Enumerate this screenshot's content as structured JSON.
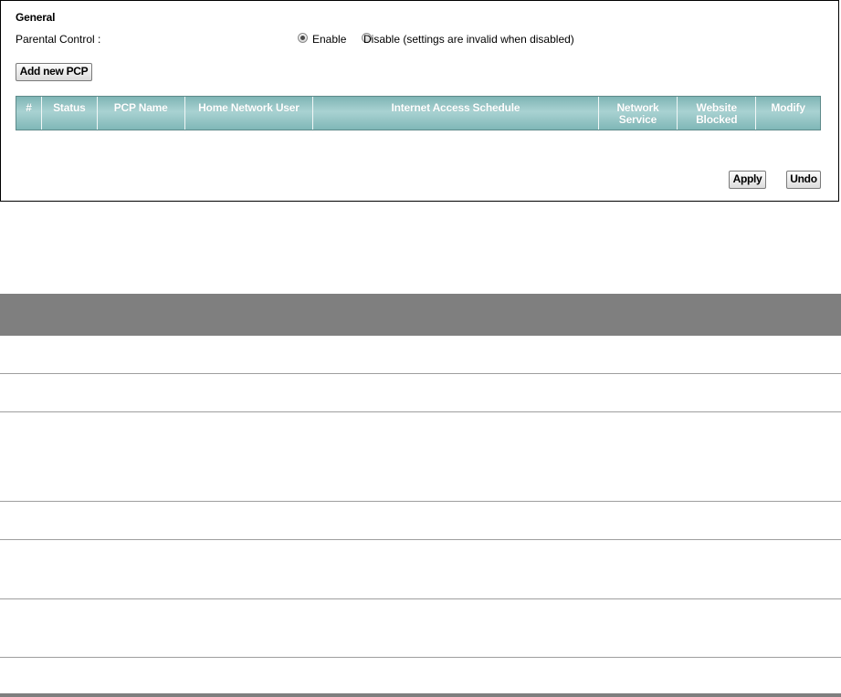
{
  "general": {
    "section_title": "General",
    "parental_control_label": "Parental Control :",
    "enable_label": "Enable",
    "disable_label": "Disable (settings are invalid when disabled)",
    "selected": "Enable"
  },
  "buttons": {
    "add_new": "Add new PCP",
    "apply": "Apply",
    "undo": "Undo"
  },
  "pcp_table": {
    "columns": [
      {
        "key": "num",
        "label": "#"
      },
      {
        "key": "status",
        "label": "Status"
      },
      {
        "key": "pcp_name",
        "label": "PCP Name"
      },
      {
        "key": "home_user",
        "label": "Home Network User"
      },
      {
        "key": "schedule",
        "label": "Internet Access Schedule"
      },
      {
        "key": "net_service",
        "label": "Network\nService"
      },
      {
        "key": "web_blocked",
        "label": "Website\nBlocked"
      },
      {
        "key": "modify",
        "label": "Modify"
      }
    ],
    "rows": []
  },
  "colors": {
    "table_header_teal": "#8fc4c4",
    "lower_header_gray": "#7f7f7f"
  }
}
